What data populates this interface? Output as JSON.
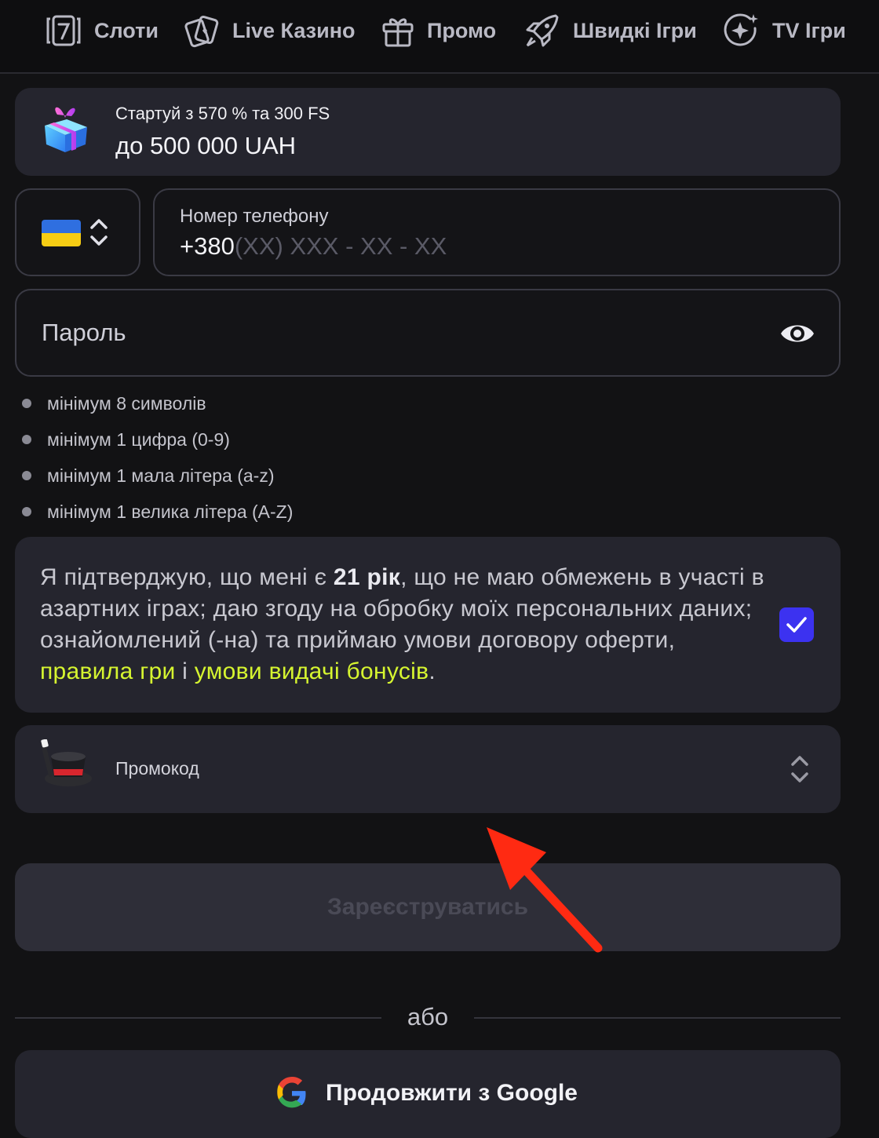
{
  "nav": {
    "items": [
      {
        "label": "Слоти",
        "icon": "slot-machine-icon"
      },
      {
        "label": "Live Казино",
        "icon": "cards-icon"
      },
      {
        "label": "Промо",
        "icon": "gift-icon"
      },
      {
        "label": "Швидкі Ігри",
        "icon": "rocket-icon"
      },
      {
        "label": "TV Ігри",
        "icon": "sparkle-icon"
      }
    ]
  },
  "bonus": {
    "line1": "Стартуй з 570 % та 300 FS",
    "line2": "до 500 000 UAH",
    "icon": "gift-box-icon"
  },
  "phone": {
    "country_flag": "ukraine-flag",
    "label": "Номер телефону",
    "prefix": "+380",
    "mask": "(XX) XXX - XX - XX"
  },
  "password": {
    "placeholder": "Пароль",
    "icon": "eye-icon"
  },
  "password_rules": [
    "мінімум 8 символів",
    "мінімум 1 цифра (0-9)",
    "мінімум 1 мала літера (a-z)",
    "мінімум 1 велика літера (A-Z)"
  ],
  "consent": {
    "text_before": "Я підтверджую, що мені є ",
    "age": "21 рік",
    "text_middle": ", що не маю обмежень в участі в азартних іграх; даю згоду на обробку моїх персональних даних; ознайомлений (-на) та приймаю умови договору оферти, ",
    "link1": "правила гри",
    "joiner": " і ",
    "link2": "умови видачі бонусів",
    "end": ".",
    "checked": true
  },
  "promo": {
    "label": "Промокод",
    "icon": "magic-hat-icon"
  },
  "register": {
    "label": "Зареєструватись"
  },
  "divider": {
    "label": "або"
  },
  "google": {
    "label": "Продовжити з Google"
  },
  "colors": {
    "background": "#121214",
    "card": "#25252e",
    "accent_link": "#d6f530",
    "checkbox": "#3c32f0",
    "annotation_arrow": "#ff2a12"
  }
}
